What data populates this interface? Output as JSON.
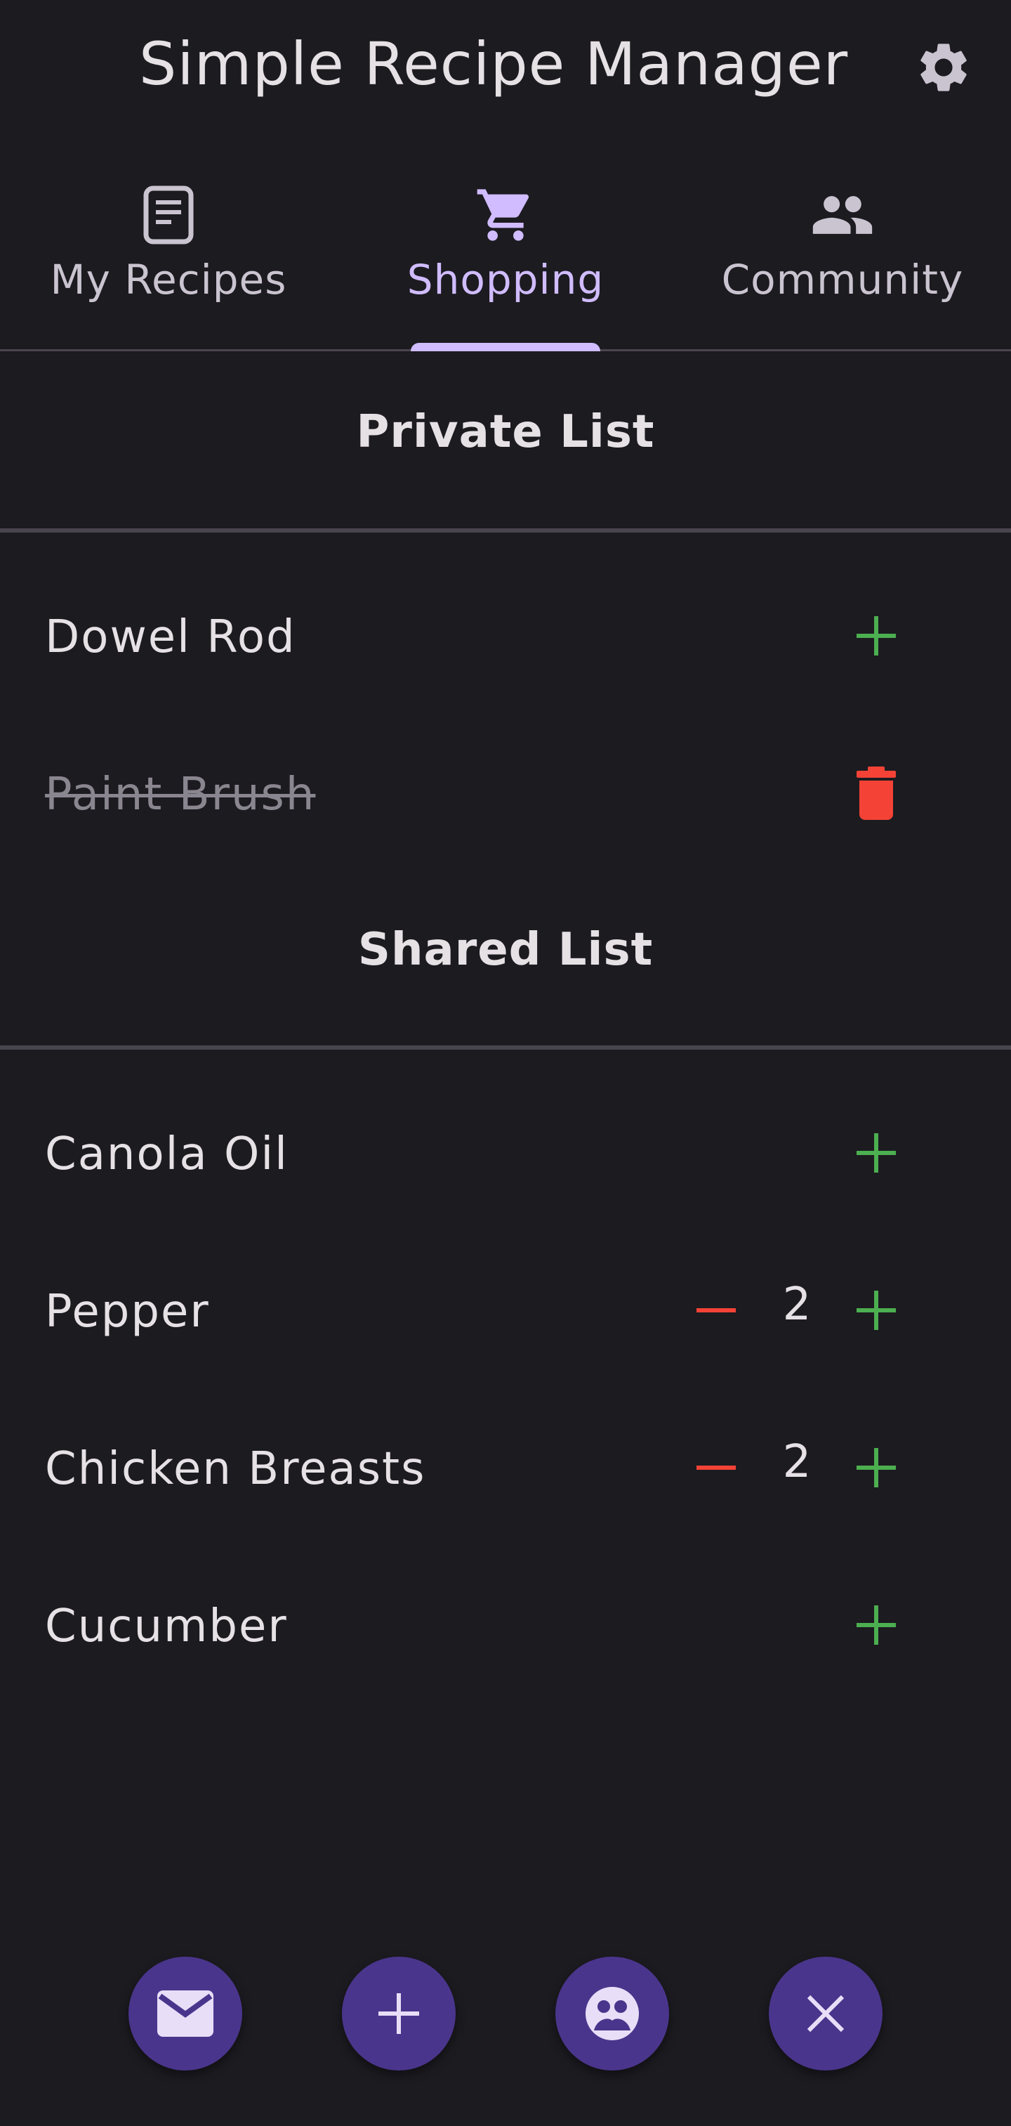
{
  "app_bar": {
    "title": "Simple Recipe Manager",
    "settings_icon": "gear-icon"
  },
  "tabs": [
    {
      "label": "My Recipes",
      "icon": "document-icon",
      "active": false
    },
    {
      "label": "Shopping",
      "icon": "cart-icon",
      "active": true
    },
    {
      "label": "Community",
      "icon": "people-icon",
      "active": false
    }
  ],
  "private_list": {
    "title": "Private List",
    "items": [
      {
        "name": "Dowel Rod",
        "checked": false
      },
      {
        "name": "Paint Brush",
        "checked": true
      }
    ]
  },
  "shared_list": {
    "title": "Shared List",
    "items": [
      {
        "name": "Canola Oil"
      },
      {
        "name": "Pepper",
        "quantity": "2"
      },
      {
        "name": "Chicken Breasts",
        "quantity": "2"
      },
      {
        "name": "Cucumber"
      }
    ]
  },
  "fabs": [
    "mail-icon",
    "plus-icon",
    "face-icon",
    "close-icon"
  ],
  "colors": {
    "background": "#1c1b20",
    "accent": "#d0bcff",
    "add": "#4caf50",
    "remove": "#f44336",
    "fab": "#4a358c"
  }
}
